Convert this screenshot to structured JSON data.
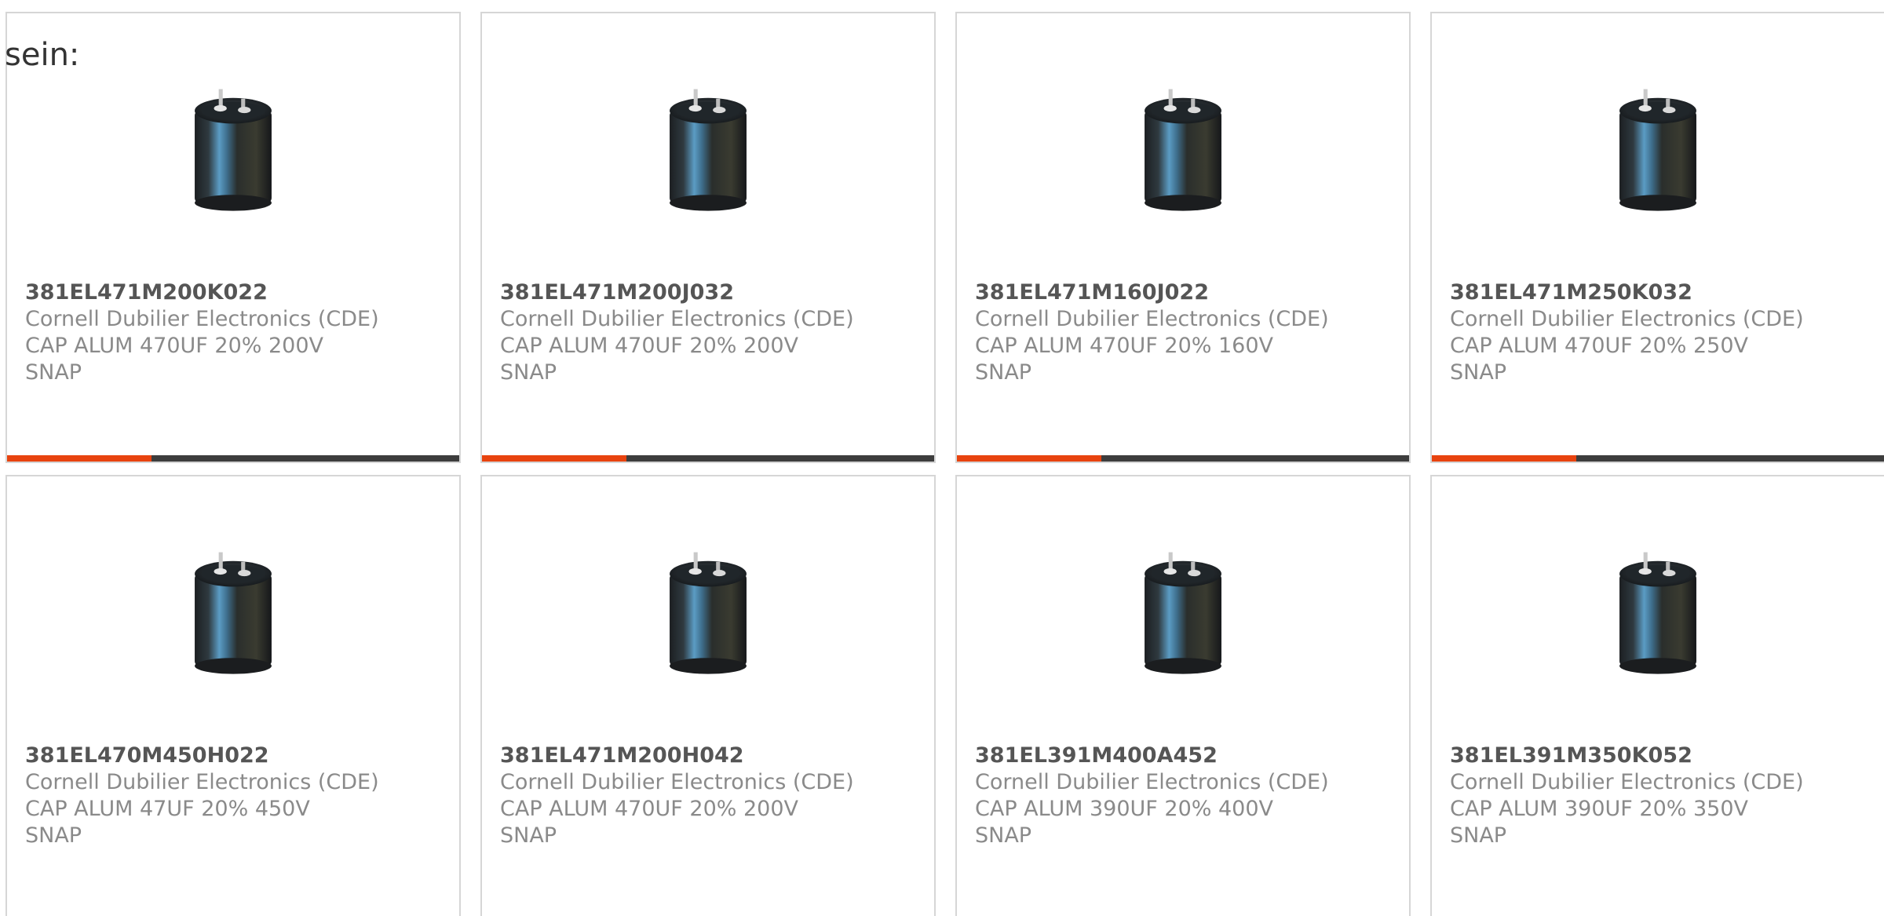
{
  "intro_text": "sein:",
  "colors": {
    "accent": "#e8430f",
    "bar_track": "#3d3d3d",
    "card_border": "#d6d6d6",
    "part_number": "#555555",
    "meta_text": "#8a8a8a"
  },
  "products": [
    {
      "part_number": "381EL471M200K022",
      "manufacturer": "Cornell Dubilier Electronics (CDE)",
      "description": "CAP ALUM 470UF 20% 200V SNAP",
      "image_icon": "capacitor-image",
      "progress": 0.32
    },
    {
      "part_number": "381EL471M200J032",
      "manufacturer": "Cornell Dubilier Electronics (CDE)",
      "description": "CAP ALUM 470UF 20% 200V SNAP",
      "image_icon": "capacitor-image",
      "progress": 0.32
    },
    {
      "part_number": "381EL471M160J022",
      "manufacturer": "Cornell Dubilier Electronics (CDE)",
      "description": "CAP ALUM 470UF 20% 160V SNAP",
      "image_icon": "capacitor-image",
      "progress": 0.32
    },
    {
      "part_number": "381EL471M250K032",
      "manufacturer": "Cornell Dubilier Electronics (CDE)",
      "description": "CAP ALUM 470UF 20% 250V SNAP",
      "image_icon": "capacitor-image",
      "progress": 0.32
    },
    {
      "part_number": "381EL470M450H022",
      "manufacturer": "Cornell Dubilier Electronics (CDE)",
      "description": "CAP ALUM 47UF 20% 450V SNAP",
      "image_icon": "capacitor-image"
    },
    {
      "part_number": "381EL471M200H042",
      "manufacturer": "Cornell Dubilier Electronics (CDE)",
      "description": "CAP ALUM 470UF 20% 200V SNAP",
      "image_icon": "capacitor-image"
    },
    {
      "part_number": "381EL391M400A452",
      "manufacturer": "Cornell Dubilier Electronics (CDE)",
      "description": "CAP ALUM 390UF 20% 400V SNAP",
      "image_icon": "capacitor-image"
    },
    {
      "part_number": "381EL391M350K052",
      "manufacturer": "Cornell Dubilier Electronics (CDE)",
      "description": "CAP ALUM 390UF 20% 350V SNAP",
      "image_icon": "capacitor-image"
    }
  ]
}
